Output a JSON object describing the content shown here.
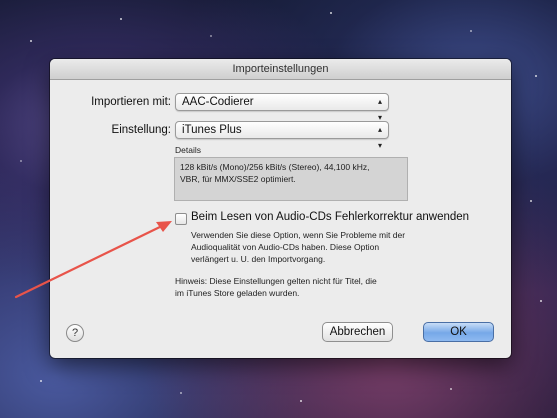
{
  "dialog": {
    "title": "Importeinstellungen",
    "import_label": "Importieren mit:",
    "import_value": "AAC-Codierer",
    "setting_label": "Einstellung:",
    "setting_value": "iTunes Plus",
    "details_label": "Details",
    "details_line1": "128 kBit/s (Mono)/256 kBit/s (Stereo), 44,100 kHz,",
    "details_line2": "VBR, für MMX/SSE2 optimiert.",
    "checkbox_label": "Beim Lesen von Audio-CDs Fehlerkorrektur anwenden",
    "checkbox_checked": false,
    "checkbox_desc_line1": "Verwenden Sie diese Option, wenn Sie Probleme mit der",
    "checkbox_desc_line2": "Audioqualität von Audio-CDs haben. Diese Option",
    "checkbox_desc_line3": "verlängert u. U. den Importvorgang.",
    "hint_line1": "Hinweis: Diese Einstellungen gelten nicht für Titel, die",
    "hint_line2": "im iTunes Store geladen wurden.",
    "help_glyph": "?",
    "cancel_label": "Abbrechen",
    "ok_label": "OK"
  },
  "annotation": {
    "arrow_color": "#e8544a"
  },
  "icons": {
    "help": "help-icon",
    "popup_arrows": "updown-chevron-icon"
  }
}
